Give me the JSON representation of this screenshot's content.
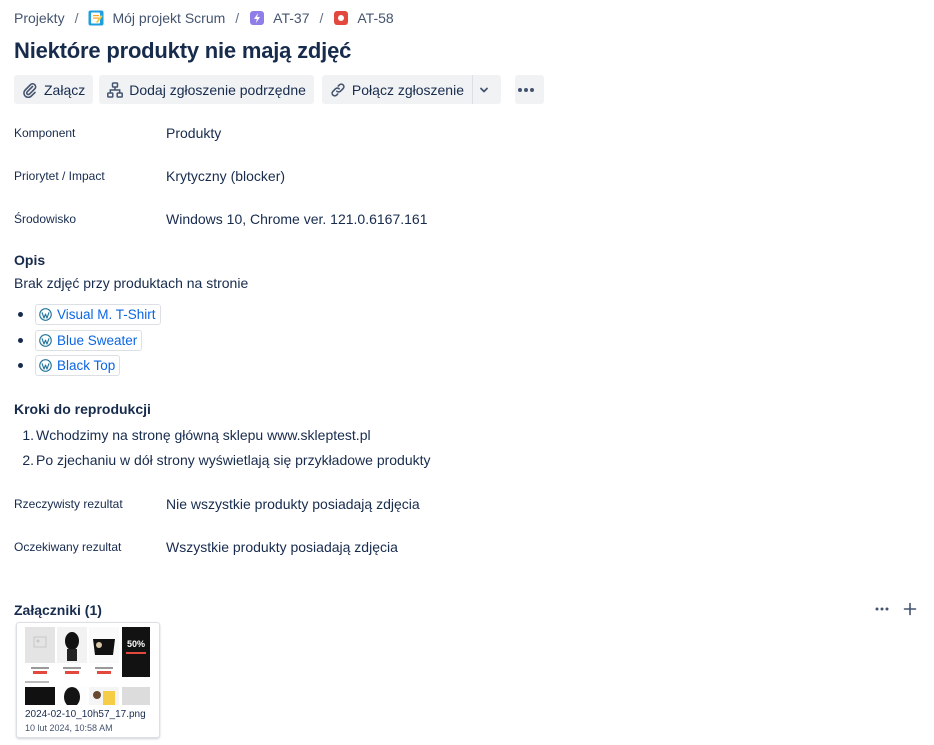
{
  "breadcrumb": {
    "projects": "Projekty",
    "project": "Mój projekt Scrum",
    "parent": "AT-37",
    "issue": "AT-58",
    "separator": "/"
  },
  "title": "Niektóre produkty nie mają zdjęć",
  "toolbar": {
    "attach": "Załącz",
    "add_child": "Dodaj zgłoszenie podrzędne",
    "link_issue": "Połącz zgłoszenie"
  },
  "fields": {
    "component": {
      "label": "Komponent",
      "value": "Produkty"
    },
    "priority": {
      "label": "Priorytet / Impact",
      "value": "Krytyczny (blocker)"
    },
    "environment": {
      "label": "Środowisko",
      "value": "Windows 10, Chrome ver. 121.0.6167.161"
    },
    "actual": {
      "label": "Rzeczywisty rezultat",
      "value": "Nie wszystkie produkty posiadają zdjęcia"
    },
    "expected": {
      "label": "Oczekiwany rezultat",
      "value": "Wszystkie produkty posiadają zdjęcia"
    }
  },
  "description": {
    "heading": "Opis",
    "text": "Brak zdjęć przy produktach na stronie",
    "links": [
      "Visual M. T-Shirt",
      "Blue Sweater",
      "Black Top"
    ]
  },
  "steps": {
    "heading": "Kroki do reprodukcji",
    "items": [
      {
        "num": "1.",
        "text": "Wchodzimy na stronę główną sklepu www.skleptest.pl"
      },
      {
        "num": "2.",
        "text": "Po zjechaniu w dół strony wyświetlają się przykładowe produkty"
      }
    ]
  },
  "attachments": {
    "heading": "Załączniki (1)",
    "items": [
      {
        "name": "2024-02-10_10h57_17.png",
        "date": "10 lut 2024, 10:58 AM",
        "thumb_badge": "50%"
      }
    ]
  },
  "colors": {
    "text": "#172b4d",
    "link": "#0c66e4",
    "button_bg": "#f1f2f4",
    "subtask_icon": "#8f7ee7",
    "bug_icon": "#e2483d"
  }
}
